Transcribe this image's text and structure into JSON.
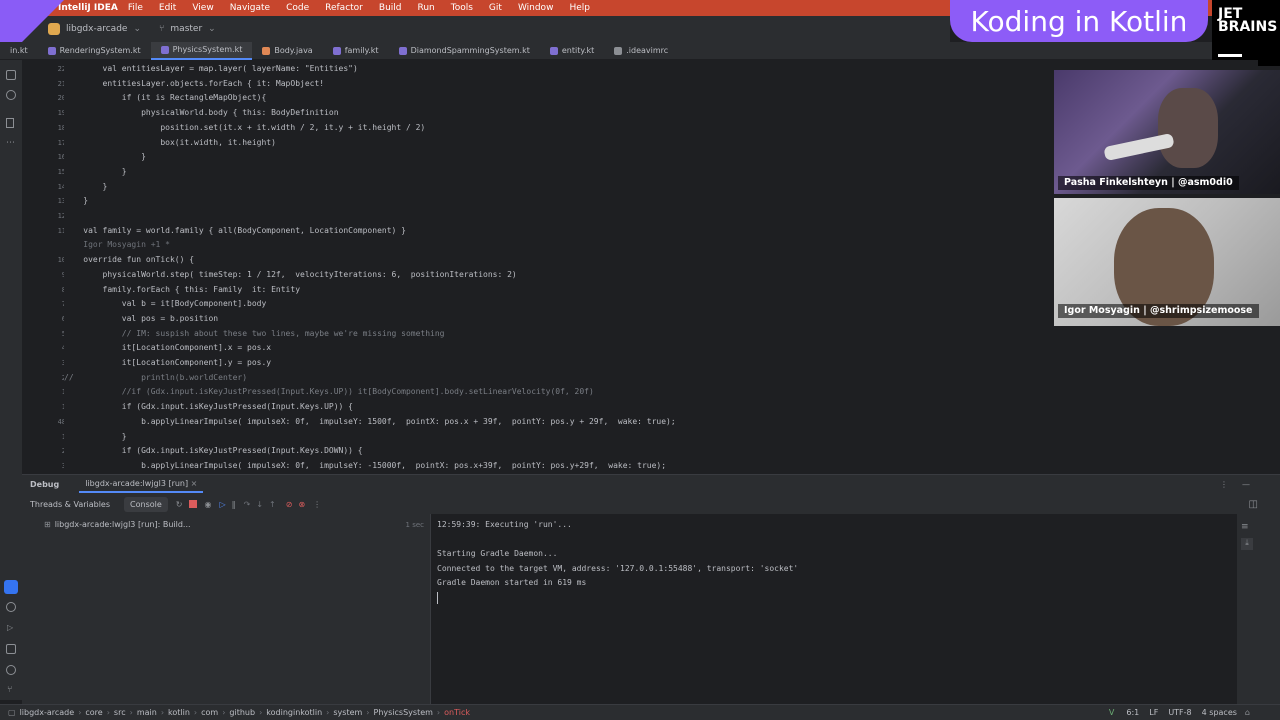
{
  "menubar": {
    "app": "IntelliJ IDEA",
    "items": [
      "File",
      "Edit",
      "View",
      "Navigate",
      "Code",
      "Refactor",
      "Build",
      "Run",
      "Tools",
      "Git",
      "Window",
      "Help"
    ]
  },
  "overlay": {
    "badge": "Koding in Kotlin",
    "brand_line1": "JET",
    "brand_line2": "BRAINS"
  },
  "toolbar": {
    "project": "libgdx-arcade",
    "branch": "master"
  },
  "tabs": [
    "in.kt",
    "RenderingSystem.kt",
    "PhysicsSystem.kt",
    "Body.java",
    "family.kt",
    "DiamondSpammingSystem.kt",
    "entity.kt",
    ".ideavimrc"
  ],
  "active_tab_index": 2,
  "editor": {
    "lines": [
      {
        "n": "22",
        "code": "        val entitiesLayer = map.layer( layerName: \"Entities\")"
      },
      {
        "n": "21",
        "code": "        entitiesLayer.objects.forEach { it: MapObject!"
      },
      {
        "n": "20",
        "code": "            if (it is RectangleMapObject){"
      },
      {
        "n": "19",
        "code": "                physicalWorld.body { this: BodyDefinition"
      },
      {
        "n": "18",
        "code": "                    position.set(it.x + it.width / 2, it.y + it.height / 2)"
      },
      {
        "n": "17",
        "code": "                    box(it.width, it.height)"
      },
      {
        "n": "16",
        "code": "                }"
      },
      {
        "n": "15",
        "code": "            }"
      },
      {
        "n": "14",
        "code": "        }"
      },
      {
        "n": "13",
        "code": "    }"
      },
      {
        "n": "12",
        "code": ""
      },
      {
        "n": "11",
        "code": "    val family = world.family { all(BodyComponent, LocationComponent) }"
      },
      {
        "n": "",
        "code": "    Igor Mosyagin +1 *"
      },
      {
        "n": "10",
        "code": "    override fun onTick() {"
      },
      {
        "n": "9",
        "code": "        physicalWorld.step( timeStep: 1 / 12f,  velocityIterations: 6,  positionIterations: 2)"
      },
      {
        "n": "8",
        "code": "        family.forEach { this: Family  it: Entity"
      },
      {
        "n": "7",
        "code": "            val b = it[BodyComponent].body"
      },
      {
        "n": "6",
        "code": "            val pos = b.position"
      },
      {
        "n": "5",
        "code": "            // IM: suspish about these two lines, maybe we're missing something"
      },
      {
        "n": "4",
        "code": "            it[LocationComponent].x = pos.x"
      },
      {
        "n": "3",
        "code": "            it[LocationComponent].y = pos.y"
      },
      {
        "n": "2",
        "code": "//              println(b.worldCenter)"
      },
      {
        "n": "1",
        "code": "            //if (Gdx.input.isKeyJustPressed(Input.Keys.UP)) it[BodyComponent].body.setLinearVelocity(0f, 20f)"
      },
      {
        "n": "1",
        "code": "            if (Gdx.input.isKeyJustPressed(Input.Keys.UP)) {"
      },
      {
        "n": "48",
        "code": "                b.applyLinearImpulse( impulseX: 0f,  impulseY: 1500f,  pointX: pos.x + 39f,  pointY: pos.y + 29f,  wake: true);"
      },
      {
        "n": "1",
        "code": "            }"
      },
      {
        "n": "2",
        "code": "            if (Gdx.input.isKeyJustPressed(Input.Keys.DOWN)) {"
      },
      {
        "n": "3",
        "code": "                b.applyLinearImpulse( impulseX: 0f,  impulseY: -15000f,  pointX: pos.x+39f,  pointY: pos.y+29f,  wake: true);"
      }
    ]
  },
  "cams": [
    {
      "name": "Pasha Finkelshteyn | @asm0di0"
    },
    {
      "name": "Igor Mosyagin | @shrimpsizemoose"
    }
  ],
  "debug": {
    "title": "Debug",
    "config": "libgdx-arcade:lwjgl3 [run]",
    "tab_threads": "Threads & Variables",
    "tab_console": "Console",
    "thread_item": "libgdx-arcade:lwjgl3 [run]: Build...",
    "duration": "1 sec"
  },
  "console": [
    "12:59:39: Executing 'run'...",
    "",
    "Starting Gradle Daemon...",
    "Connected to the target VM, address: '127.0.0.1:55488', transport: 'socket'",
    "Gradle Daemon started in 619 ms"
  ],
  "status": {
    "crumbs": [
      "libgdx-arcade",
      "core",
      "src",
      "main",
      "kotlin",
      "com",
      "github",
      "kodinginkotlin",
      "system",
      "PhysicsSystem",
      "onTick"
    ],
    "pos": "6:1",
    "le": "LF",
    "enc": "UTF-8",
    "indent": "4 spaces"
  }
}
